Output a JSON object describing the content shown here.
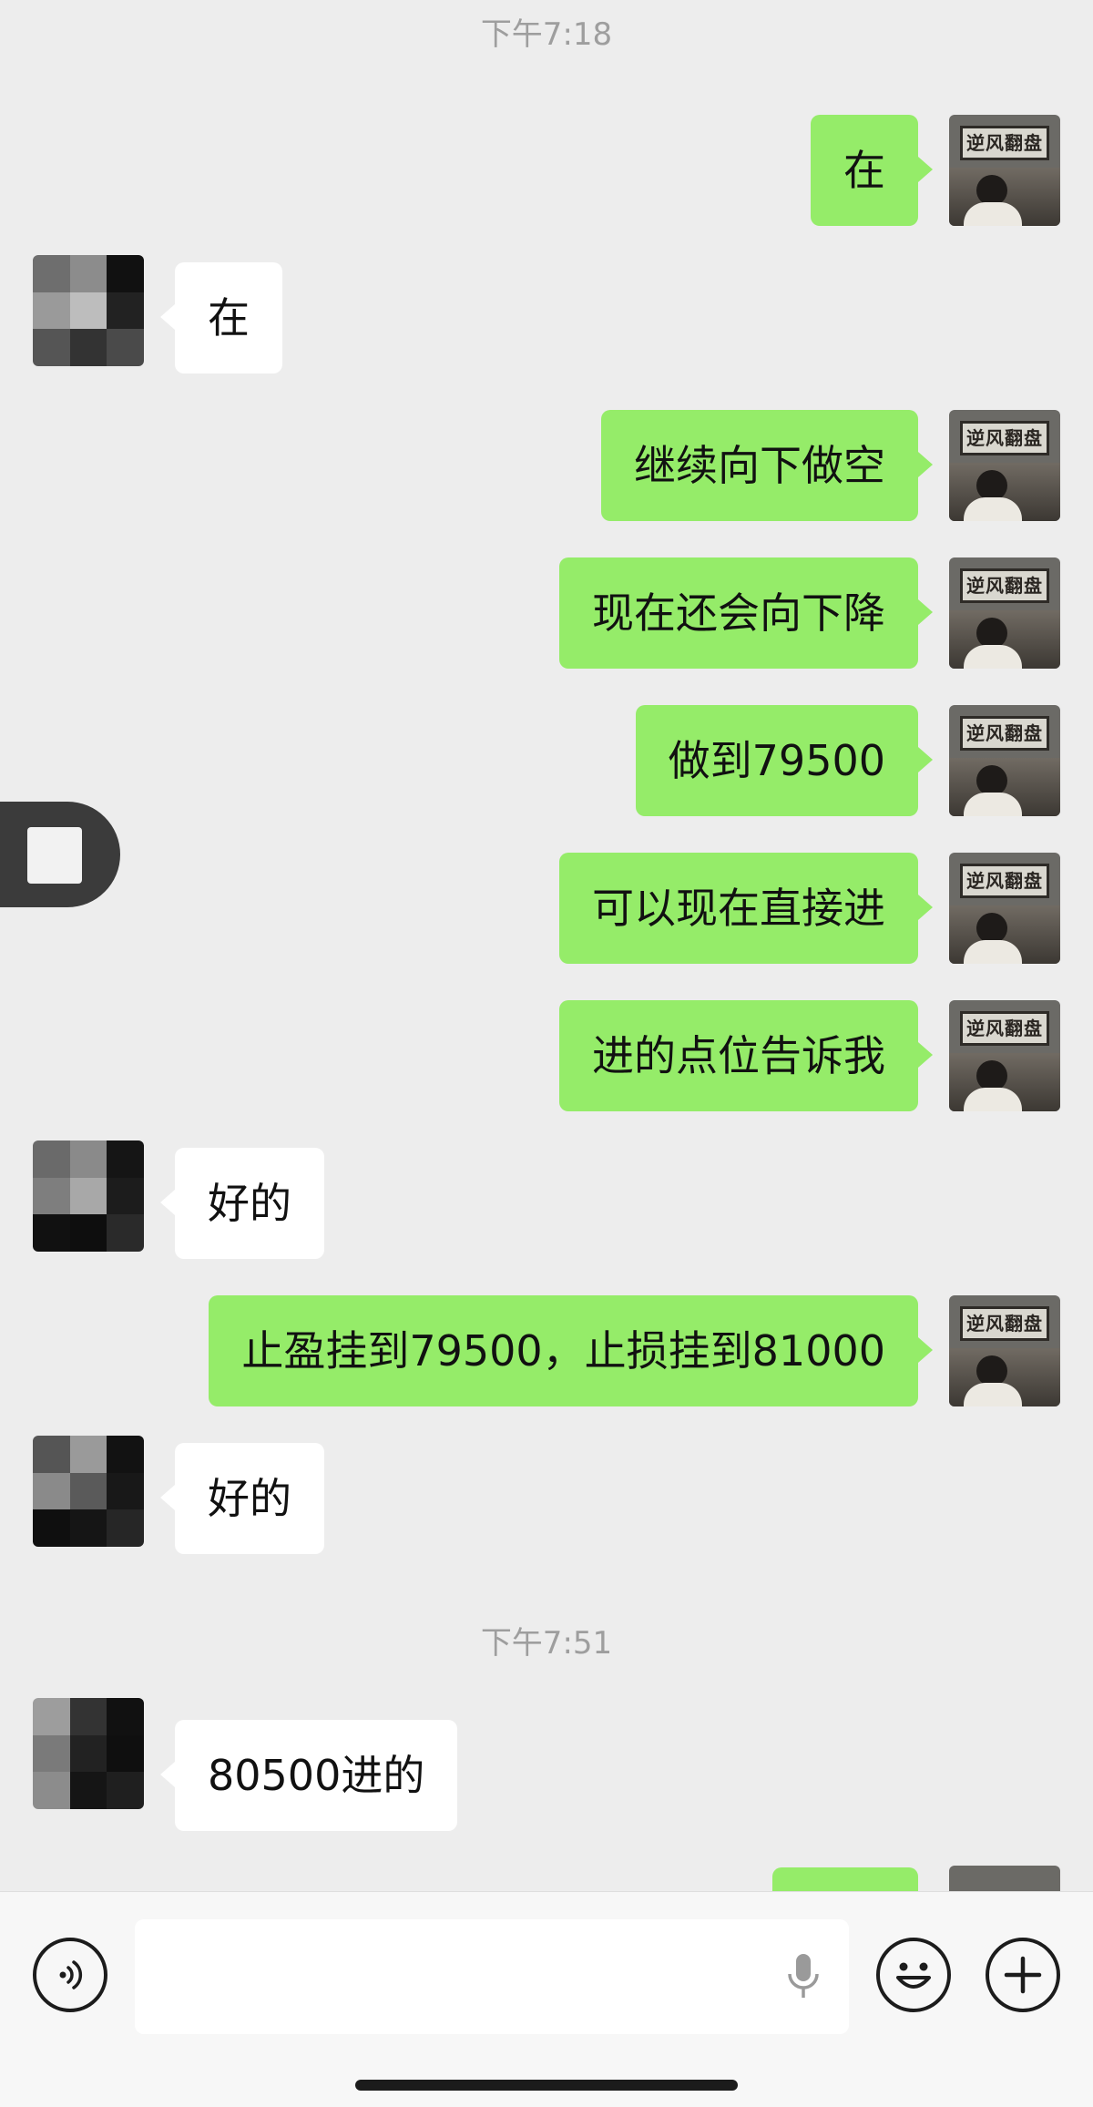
{
  "timestamps": [
    "下午7:18",
    "下午7:51"
  ],
  "messages": [
    {
      "side": "me",
      "text": "在"
    },
    {
      "side": "them",
      "text": "在"
    },
    {
      "side": "me",
      "text": "继续向下做空"
    },
    {
      "side": "me",
      "text": "现在还会向下降"
    },
    {
      "side": "me",
      "text": "做到79500"
    },
    {
      "side": "me",
      "text": "可以现在直接进"
    },
    {
      "side": "me",
      "text": "进的点位告诉我"
    },
    {
      "side": "them",
      "text": "好的"
    },
    {
      "side": "me",
      "text": "止盈挂到79500，止损挂到81000"
    },
    {
      "side": "them",
      "text": "好的"
    },
    {
      "side": "them",
      "text": "80500进的"
    }
  ],
  "avatars": {
    "me": {
      "icon": "user-avatar-icon",
      "sign_text": "逆风翻盘"
    },
    "contact": {
      "icon": "pixelated-avatar-icon"
    }
  },
  "input_bar": {
    "left_icon": "voice-icon",
    "field_icon": "microphone-icon",
    "emoji_icon": "emoji-icon",
    "plus_icon": "plus-icon"
  },
  "colors": {
    "background": "#ededed",
    "outgoing_bubble": "#95ec69",
    "incoming_bubble": "#ffffff",
    "timestamp": "#9e9e9e"
  }
}
